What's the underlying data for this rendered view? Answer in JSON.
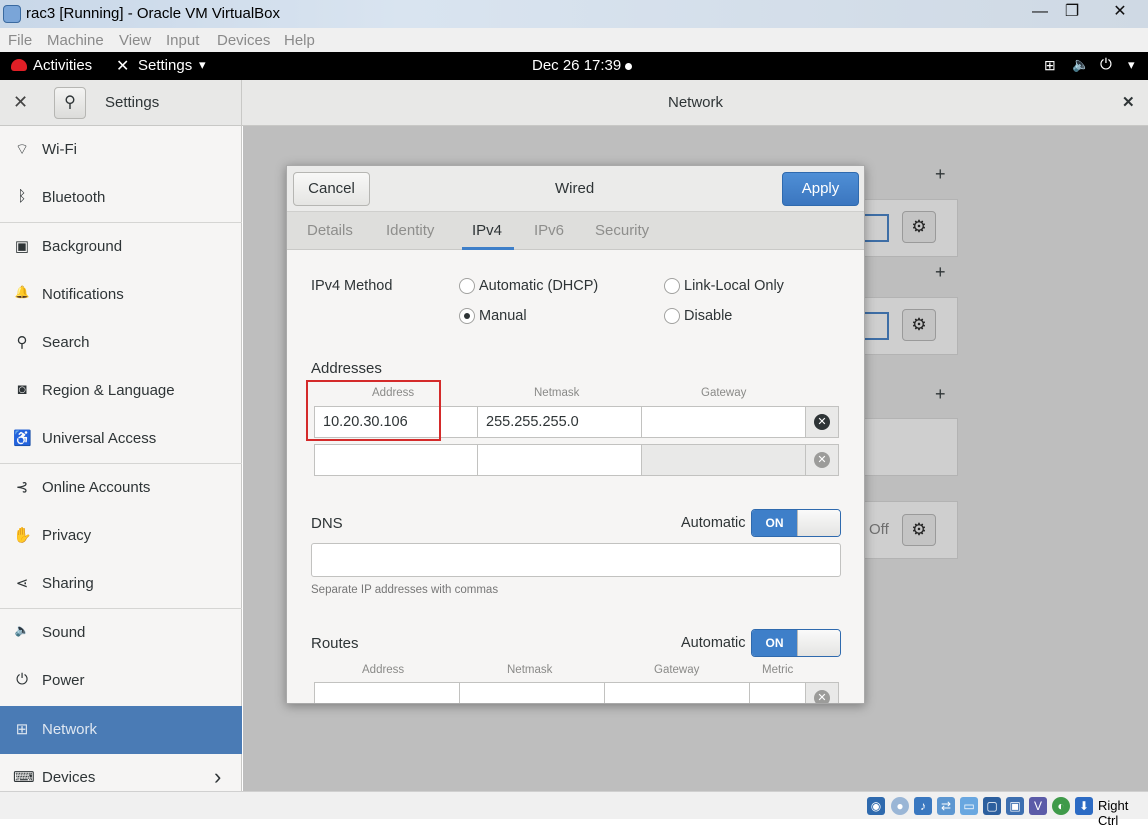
{
  "window": {
    "title": "rac3 [Running] - Oracle VM VirtualBox",
    "minimize": "—",
    "restore": "❐",
    "close": "✕"
  },
  "vbox_menu": [
    "File",
    "Machine",
    "View",
    "Input",
    "Devices",
    "Help"
  ],
  "gnome_bar": {
    "activities": "Activities",
    "app_menu": "Settings",
    "clock": "Dec 26  17:39",
    "arrow": "▾"
  },
  "settings": {
    "title": "Settings",
    "panel_title": "Network",
    "close": "✕"
  },
  "sidebar": {
    "items": [
      {
        "label": "Wi-Fi",
        "icon": "wifi-icon",
        "glyph": "⌔"
      },
      {
        "label": "Bluetooth",
        "icon": "bluetooth-icon",
        "glyph": "ᛒ"
      },
      {
        "label": "Background",
        "icon": "background-icon",
        "glyph": "▣"
      },
      {
        "label": "Notifications",
        "icon": "bell-icon",
        "glyph": "🔔"
      },
      {
        "label": "Search",
        "icon": "search-icon",
        "glyph": "⚲"
      },
      {
        "label": "Region & Language",
        "icon": "camera-icon",
        "glyph": "◙"
      },
      {
        "label": "Universal Access",
        "icon": "accessibility-icon",
        "glyph": "♿"
      },
      {
        "label": "Online Accounts",
        "icon": "online-accounts-icon",
        "glyph": "⊰"
      },
      {
        "label": "Privacy",
        "icon": "hand-icon",
        "glyph": "✋"
      },
      {
        "label": "Sharing",
        "icon": "share-icon",
        "glyph": "⋖"
      },
      {
        "label": "Sound",
        "icon": "speaker-icon",
        "glyph": "🔈"
      },
      {
        "label": "Power",
        "icon": "power-icon",
        "glyph": "⏻"
      },
      {
        "label": "Network",
        "icon": "network-icon",
        "glyph": "⊞"
      },
      {
        "label": "Devices",
        "icon": "devices-icon",
        "glyph": "⌨"
      }
    ],
    "active": "Network",
    "devices_arrow": "›"
  },
  "background_panel": {
    "plus": "+",
    "off_text": "Off",
    "gear": "⚙"
  },
  "dialog": {
    "title": "Wired",
    "cancel": "Cancel",
    "apply": "Apply",
    "tabs": [
      "Details",
      "Identity",
      "IPv4",
      "IPv6",
      "Security"
    ],
    "active_tab": "IPv4",
    "ipv4_method_label": "IPv4 Method",
    "methods": {
      "auto": "Automatic (DHCP)",
      "link_local": "Link-Local Only",
      "manual": "Manual",
      "disable": "Disable"
    },
    "selected_method": "Manual",
    "addresses": {
      "label": "Addresses",
      "col_address": "Address",
      "col_netmask": "Netmask",
      "col_gateway": "Gateway",
      "rows": [
        {
          "address": "10.20.30.106",
          "netmask": "255.255.255.0",
          "gateway": ""
        },
        {
          "address": "",
          "netmask": "",
          "gateway": ""
        }
      ]
    },
    "dns": {
      "label": "DNS",
      "automatic_label": "Automatic",
      "switch": "ON",
      "value": "",
      "hint": "Separate IP addresses with commas"
    },
    "routes": {
      "label": "Routes",
      "automatic_label": "Automatic",
      "switch": "ON",
      "col_address": "Address",
      "col_netmask": "Netmask",
      "col_gateway": "Gateway",
      "col_metric": "Metric"
    }
  },
  "status_bar": {
    "host_key": "Right Ctrl"
  },
  "colors": {
    "accent": "#3e7fc9",
    "sidebar_active": "#4a7bb5",
    "highlight_box": "#d42a2a"
  }
}
